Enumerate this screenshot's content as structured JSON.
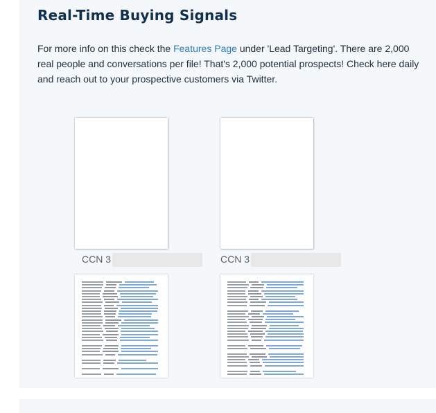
{
  "section": {
    "title": "Real-Time Buying Signals",
    "desc_before_link": "For more info on this check the ",
    "link_text": "Features Page",
    "desc_after_link": " under 'Lead Targeting'. There are 2,000 real people and conversations per file! That's 2,000 potential prospects! Check here daily and reach out to your prospective customers via Twitter."
  },
  "files": [
    {
      "caption": "CCN 3"
    },
    {
      "caption": "CCN 3"
    }
  ]
}
